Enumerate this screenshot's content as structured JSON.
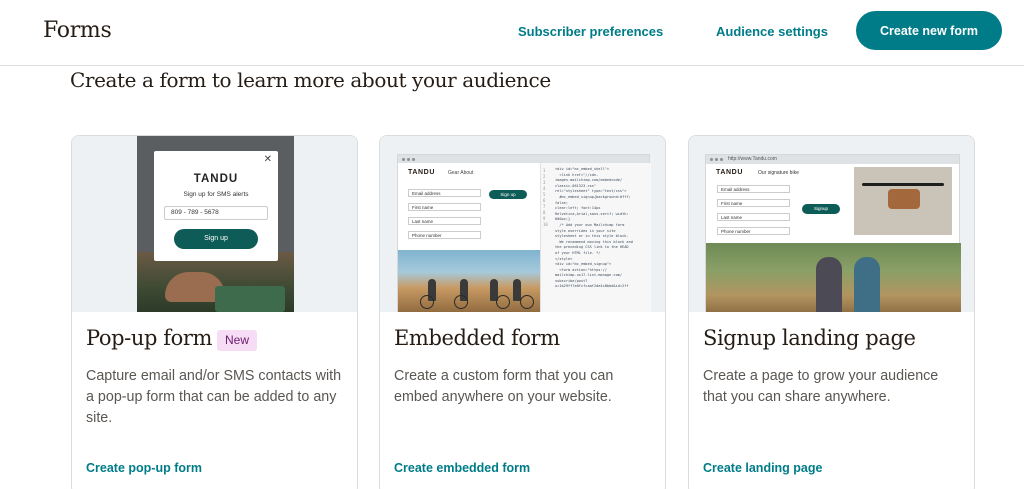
{
  "header": {
    "title": "Forms",
    "nav": {
      "subscriber_preferences": "Subscriber preferences",
      "audience_settings": "Audience settings"
    },
    "create_button": "Create new form"
  },
  "main": {
    "heading": "Create a form to learn more about your audience",
    "cards": [
      {
        "title": "Pop-up form",
        "badge": "New",
        "description": "Capture email and/or SMS contacts with a pop-up form that can be added to any site.",
        "link": "Create pop-up form",
        "preview": {
          "logo": "TANDU",
          "subtitle": "Sign up for SMS alerts",
          "phone": "809 - 789 - 5678",
          "button": "Sign up",
          "close_icon": "close-icon"
        }
      },
      {
        "title": "Embedded form",
        "description": "Create a custom form that you can embed anywhere on your website.",
        "link": "Create embedded form",
        "preview": {
          "logo": "TANDU",
          "nav": "Gear   About",
          "fields": [
            "Email address",
            "First name",
            "Last name",
            "Phone number"
          ],
          "button": "Sign up",
          "line_numbers": "1\n2\n3\n4\n5\n6\n7\n8\n9\n10",
          "code": "<div id=\"mc_embed_shell\">\n  <link href=\"//cdn-\nimages.mailchimp.com/embedcode/\nclassic-061523.css\"\nrel=\"stylesheet\" type=\"text/css\">\n  #mc_embed_signup{background:#fff;\nfalse;\nclear:left; font:14px\nHelvetica,Arial,sans-serif; width:\n600px;}\n  /* Add your own Mailchimp form\nstyle overrides in your site\nstylesheet or in this style block.\n  We recommend moving this block and\nthe preceding CSS link to the HEAD\nof your HTML file. */\n</style>\n<div id=\"mc_embed_signup\">\n  <form action=\"https://\nmailchimp.us17.list-manage.com/\nsubscribe/post?\nu=1b29ff7e8fcfcaaf2de4c8bbd&id=2ff"
        }
      },
      {
        "title": "Signup landing page",
        "description": "Create a page to grow your audience that you can share anywhere.",
        "link": "Create landing page",
        "preview": {
          "url": "http://www.Tandu.com",
          "logo": "TANDU",
          "tagline": "Our signature bike",
          "fields": [
            "Email address",
            "First name",
            "Last name",
            "Phone number"
          ],
          "button": "Signup"
        }
      }
    ]
  },
  "colors": {
    "accent": "#007c89",
    "button_dark": "#0e5c57",
    "badge_bg": "#f6dcf5",
    "text": "#241c15"
  }
}
